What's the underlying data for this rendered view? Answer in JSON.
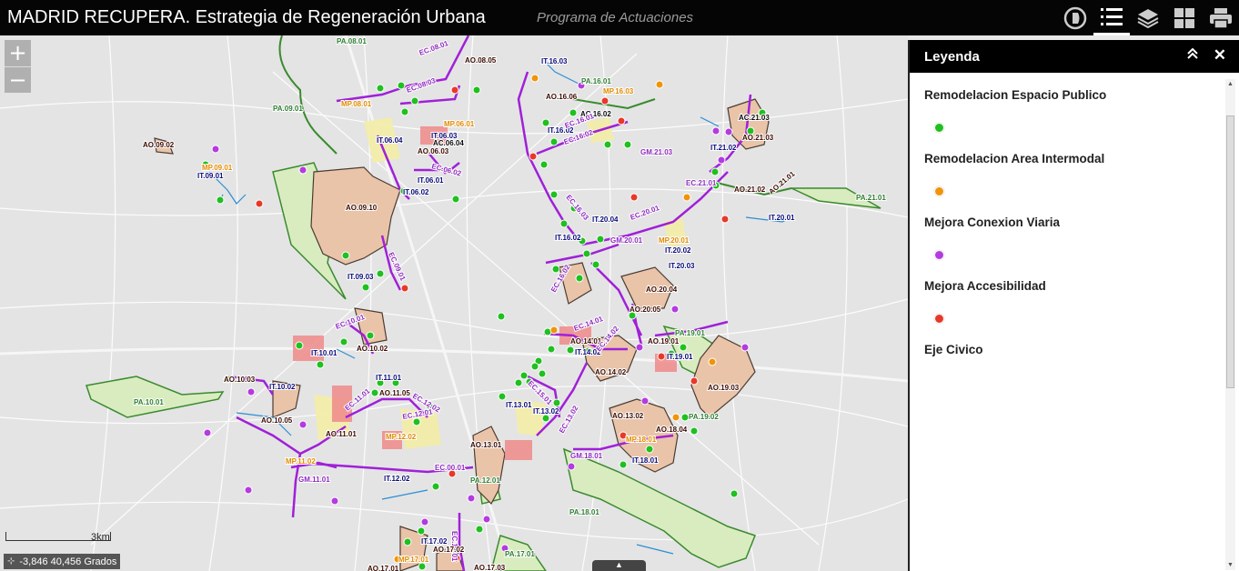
{
  "header": {
    "title": "MADRID RECUPERA. Estrategia de Regeneración Urbana",
    "subtitle": "Programa de Actuaciones",
    "tools": [
      "about-icon",
      "legend-icon",
      "layers-icon",
      "basemap-gallery-icon",
      "print-icon"
    ]
  },
  "map": {
    "zoom_in": "+",
    "zoom_out": "−",
    "scale_label": "3km",
    "coordinates": "-3,846 40,456 Grados",
    "attribution_toggle": "▲",
    "labels": [
      {
        "text": "PA.08.01",
        "color": "#2e7d32"
      },
      {
        "text": "AO.08.05",
        "color": "#3a0a00"
      },
      {
        "text": "EC.08.01",
        "color": "#8e2bbf"
      },
      {
        "text": "EC.08.03",
        "color": "#8e2bbf"
      },
      {
        "text": "PA.09.01",
        "color": "#2e7d32"
      },
      {
        "text": "MP.08.01",
        "color": "#e08a00"
      },
      {
        "text": "MP.06.01",
        "color": "#e08a00"
      },
      {
        "text": "IT.06.04",
        "color": "#0a0a7a"
      },
      {
        "text": "IT.06.03",
        "color": "#0a0a7a"
      },
      {
        "text": "AC.06.04",
        "color": "#0a0a0a"
      },
      {
        "text": "AO.06.03",
        "color": "#3a0a00"
      },
      {
        "text": "EC.06.02",
        "color": "#8e2bbf"
      },
      {
        "text": "IT.06.01",
        "color": "#0a0a7a"
      },
      {
        "text": "IT.06.02",
        "color": "#0a0a7a"
      },
      {
        "text": "AO.09.02",
        "color": "#3a0a00"
      },
      {
        "text": "MP.09.01",
        "color": "#e08a00"
      },
      {
        "text": "IT.09.01",
        "color": "#0a0a7a"
      },
      {
        "text": "AO.09.10",
        "color": "#3a0a00"
      },
      {
        "text": "EC.09.01",
        "color": "#8e2bbf"
      },
      {
        "text": "IT.09.03",
        "color": "#0a0a7a"
      },
      {
        "text": "IT.16.03",
        "color": "#0a0a7a"
      },
      {
        "text": "PA.16.01",
        "color": "#2e7d32"
      },
      {
        "text": "MP.16.03",
        "color": "#e08a00"
      },
      {
        "text": "AO.16.06",
        "color": "#3a0a00"
      },
      {
        "text": "AC.16.02",
        "color": "#0a0a0a"
      },
      {
        "text": "IT.16.02",
        "color": "#0a0a7a"
      },
      {
        "text": "EC.16.01",
        "color": "#8e2bbf"
      },
      {
        "text": "EC.16.02",
        "color": "#8e2bbf"
      },
      {
        "text": "GM.21.03",
        "color": "#8e2bbf"
      },
      {
        "text": "AC.21.03",
        "color": "#0a0a0a"
      },
      {
        "text": "AO.21.03",
        "color": "#3a0a00"
      },
      {
        "text": "IT.21.02",
        "color": "#0a0a7a"
      },
      {
        "text": "EC.21.01",
        "color": "#8e2bbf"
      },
      {
        "text": "AO.21.02",
        "color": "#3a0a00"
      },
      {
        "text": "AO.21.01",
        "color": "#3a0a00"
      },
      {
        "text": "PA.21.01",
        "color": "#2e7d32"
      },
      {
        "text": "IT.20.01",
        "color": "#0a0a7a"
      },
      {
        "text": "EC.16.03",
        "color": "#8e2bbf"
      },
      {
        "text": "IT.20.04",
        "color": "#0a0a7a"
      },
      {
        "text": "EC.20.01",
        "color": "#8e2bbf"
      },
      {
        "text": "IT.16.02",
        "color": "#0a0a7a"
      },
      {
        "text": "GM.20.01",
        "color": "#8e2bbf"
      },
      {
        "text": "MP.20.01",
        "color": "#e08a00"
      },
      {
        "text": "IT.20.02",
        "color": "#0a0a7a"
      },
      {
        "text": "IT.20.03",
        "color": "#0a0a7a"
      },
      {
        "text": "EC.16.02",
        "color": "#8e2bbf"
      },
      {
        "text": "AO.20.04",
        "color": "#3a0a00"
      },
      {
        "text": "AO.20.05",
        "color": "#3a0a00"
      },
      {
        "text": "EC.10.01",
        "color": "#8e2bbf"
      },
      {
        "text": "IT.10.01",
        "color": "#0a0a7a"
      },
      {
        "text": "AO.10.02",
        "color": "#3a0a00"
      },
      {
        "text": "AO.10.03",
        "color": "#3a0a00"
      },
      {
        "text": "IT.10.02",
        "color": "#0a0a7a"
      },
      {
        "text": "PA.10.01",
        "color": "#2e7d32"
      },
      {
        "text": "IT.11.01",
        "color": "#0a0a7a"
      },
      {
        "text": "AO.11.05",
        "color": "#3a0a00"
      },
      {
        "text": "EC.11.01",
        "color": "#8e2bbf"
      },
      {
        "text": "EC.12.02",
        "color": "#8e2bbf"
      },
      {
        "text": "AO.10.05",
        "color": "#3a0a00"
      },
      {
        "text": "AO.11.01",
        "color": "#3a0a00"
      },
      {
        "text": "EC.12.01",
        "color": "#8e2bbf"
      },
      {
        "text": "MP.12.02",
        "color": "#e08a00"
      },
      {
        "text": "MP.11.02",
        "color": "#e08a00"
      },
      {
        "text": "GM.11.01",
        "color": "#8e2bbf"
      },
      {
        "text": "EC.00.01",
        "color": "#8e2bbf"
      },
      {
        "text": "IT.12.02",
        "color": "#0a0a7a"
      },
      {
        "text": "EC.14.01",
        "color": "#8e2bbf"
      },
      {
        "text": "AO.14.01",
        "color": "#3a0a00"
      },
      {
        "text": "IT.14.02",
        "color": "#0a0a7a"
      },
      {
        "text": "EC.14.02",
        "color": "#8e2bbf"
      },
      {
        "text": "AO.14.02",
        "color": "#3a0a00"
      },
      {
        "text": "EC.15.01",
        "color": "#8e2bbf"
      },
      {
        "text": "IT.13.01",
        "color": "#0a0a7a"
      },
      {
        "text": "IT.13.02",
        "color": "#0a0a7a"
      },
      {
        "text": "EC.13.02",
        "color": "#8e2bbf"
      },
      {
        "text": "AO.13.01",
        "color": "#3a0a00"
      },
      {
        "text": "PA.12.01",
        "color": "#2e7d32"
      },
      {
        "text": "AO.19.01",
        "color": "#3a0a00"
      },
      {
        "text": "PA.19.01",
        "color": "#2e7d32"
      },
      {
        "text": "IT.19.01",
        "color": "#0a0a7a"
      },
      {
        "text": "AO.19.03",
        "color": "#3a0a00"
      },
      {
        "text": "AO.13.02",
        "color": "#3a0a00"
      },
      {
        "text": "AO.18.04",
        "color": "#3a0a00"
      },
      {
        "text": "PA.19.02",
        "color": "#2e7d32"
      },
      {
        "text": "MP.18.01",
        "color": "#e08a00"
      },
      {
        "text": "GM.18.01",
        "color": "#8e2bbf"
      },
      {
        "text": "IT.18.01",
        "color": "#0a0a7a"
      },
      {
        "text": "PA.18.01",
        "color": "#2e7d32"
      },
      {
        "text": "IT.17.02",
        "color": "#0a0a7a"
      },
      {
        "text": "EC.17.01",
        "color": "#8e2bbf"
      },
      {
        "text": "AO.17.02",
        "color": "#3a0a00"
      },
      {
        "text": "MP.17.01",
        "color": "#e08a00"
      },
      {
        "text": "AO.17.01",
        "color": "#3a0a00"
      },
      {
        "text": "AO.17.03",
        "color": "#3a0a00"
      },
      {
        "text": "PA.17.01",
        "color": "#2e7d32"
      }
    ]
  },
  "legend": {
    "title": "Leyenda",
    "collapse_icon": "chevrons-up-icon",
    "close_label": "✕",
    "items": [
      {
        "label": "Remodelacion Espacio Publico",
        "color": "#1fc01f"
      },
      {
        "label": "Remodelacion Area Intermodal",
        "color": "#f0940a"
      },
      {
        "label": "Mejora Conexion Viaria",
        "color": "#b43be0"
      },
      {
        "label": "Mejora Accesibilidad",
        "color": "#e8382a"
      },
      {
        "label": "Eje Civico",
        "color": ""
      }
    ]
  }
}
